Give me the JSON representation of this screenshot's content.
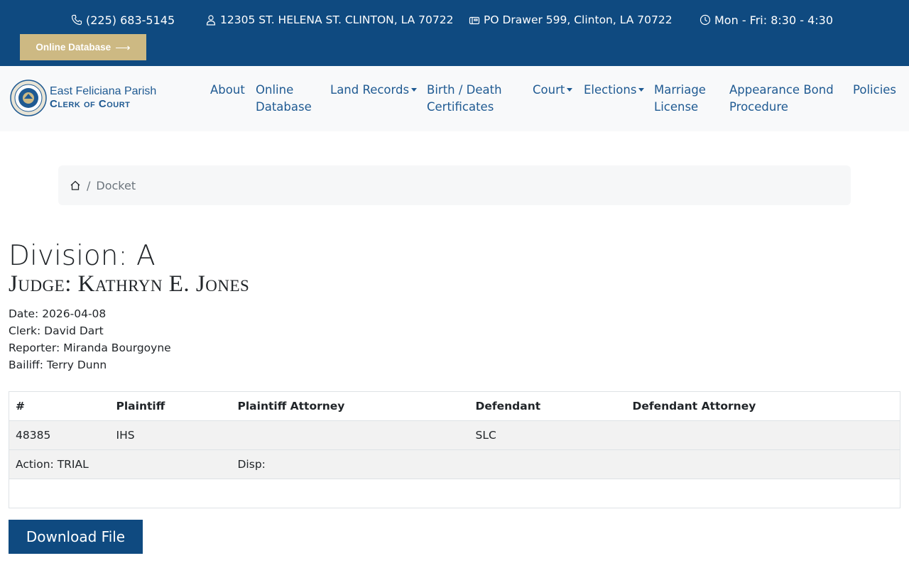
{
  "topbar": {
    "phone": "(225) 683-5145",
    "address": "12305 ST. HELENA ST. CLINTON, LA 70722",
    "po_box": "PO Drawer 599, Clinton, LA 70722",
    "hours": "Mon - Fri: 8:30 - 4:30",
    "online_button": "Online Database",
    "icons": [
      "phone-icon",
      "person-icon",
      "mailbox-icon",
      "clock-icon",
      "arrow-right-icon"
    ]
  },
  "logo": {
    "line1": "East Feliciana Parish",
    "line2": "Clerk of Court"
  },
  "nav": {
    "about": "About",
    "online_db_1": "Online",
    "online_db_2": "Database",
    "land_records": "Land Records",
    "birth_1": "Birth / Death",
    "birth_2": "Certificates",
    "court": "Court",
    "elections": "Elections",
    "marriage_1": "Marriage",
    "marriage_2": "License",
    "bond_1": "Appearance Bond",
    "bond_2": "Procedure",
    "policies": "Policies"
  },
  "breadcrumb": {
    "current": "Docket",
    "separator": "/"
  },
  "docket": {
    "division": "Division: A",
    "judge": "Judge: Kathryn E. Jones",
    "date": "Date: 2026-04-08",
    "clerk": "Clerk: David Dart",
    "reporter": "Reporter: Miranda Bourgoyne",
    "bailiff": "Bailiff: Terry Dunn"
  },
  "table": {
    "headers": [
      "#",
      "Plaintiff",
      "Plaintiff Attorney",
      "Defendant",
      "Defendant Attorney"
    ],
    "row": {
      "number": "48385",
      "plaintiff": "IHS",
      "plaintiff_attorney": "",
      "defendant": "SLC",
      "defendant_attorney": ""
    },
    "action": "Action: TRIAL",
    "disp": "Disp:"
  },
  "download_button": "Download File",
  "colors": {
    "primary": "#0f4a80",
    "gold": "#cdb983",
    "link": "#1f5a92"
  }
}
